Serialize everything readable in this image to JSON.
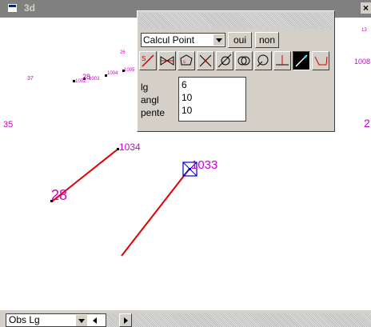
{
  "window": {
    "title": "3d",
    "close_label": "×"
  },
  "tool_window": {
    "mode_select_value": "Calcul Point",
    "yes_label": "oui",
    "no_label": "non",
    "tools": [
      {
        "icon": "perpendicular-distance-icon",
        "active": false
      },
      {
        "icon": "bow-tie-icon",
        "active": false
      },
      {
        "icon": "polygon-label-icon",
        "active": false
      },
      {
        "icon": "line-intersection-icon",
        "active": false
      },
      {
        "icon": "line-circle-icon",
        "active": false
      },
      {
        "icon": "two-circles-icon",
        "active": false
      },
      {
        "icon": "circle-polygon-icon",
        "active": false
      },
      {
        "icon": "perpendicular-icon",
        "active": false
      },
      {
        "icon": "extend-line-icon",
        "active": true
      },
      {
        "icon": "angle-icon",
        "active": false
      }
    ],
    "fields": [
      {
        "label": "lg",
        "value": "6"
      },
      {
        "label": "angl",
        "value": "10"
      },
      {
        "label": "pente",
        "value": "10"
      }
    ]
  },
  "canvas": {
    "point_labels": [
      {
        "text": "26"
      },
      {
        "text": "37"
      },
      {
        "text": "1002"
      },
      {
        "text": "28"
      },
      {
        "text": "1003"
      },
      {
        "text": "1004"
      },
      {
        "text": "1005"
      },
      {
        "text": "1034"
      },
      {
        "text": "28"
      },
      {
        "text": "1033"
      },
      {
        "text": "35"
      },
      {
        "text": "13"
      },
      {
        "text": "1008"
      },
      {
        "text": "2"
      }
    ]
  },
  "statusbar": {
    "select_value": "Obs Lg"
  },
  "colors": {
    "label": "#cc00cc",
    "line": "#e00000",
    "selection": "#0000cc",
    "chrome": "#d4d0c8"
  }
}
